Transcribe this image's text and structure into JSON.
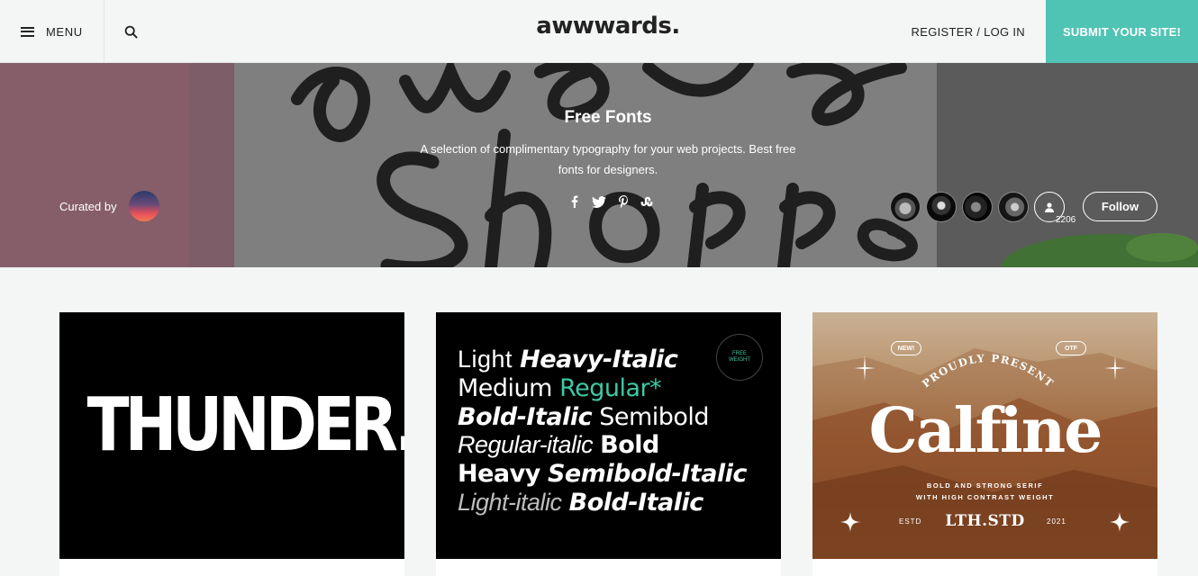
{
  "header": {
    "menu_label": "MENU",
    "logo": "awwwards.",
    "login_label": "REGISTER / LOG IN",
    "submit_label": "SUBMIT YOUR SITE!"
  },
  "hero": {
    "title": "Free Fonts",
    "description_line1": "A selection of complimentary typography for your web projects. Best free",
    "description_line2": "fonts for designers.",
    "curated_by_label": "Curated by",
    "social_icons": [
      "facebook-icon",
      "twitter-icon",
      "pinterest-icon",
      "stumbleupon-icon"
    ],
    "follower_count": "2206",
    "follow_label": "Follow"
  },
  "cards": [
    {
      "thumb_text": "THUNDER."
    },
    {
      "rows": [
        [
          "Light",
          "Heavy-Italic"
        ],
        [
          "Medium",
          "Regular*"
        ],
        [
          "Bold-Italic",
          "Semibold"
        ],
        [
          "Regular-italic",
          "Bold"
        ],
        [
          "Heavy",
          "Semibold-Italic"
        ],
        [
          "Light-italic",
          "Bold-Italic"
        ]
      ],
      "badge_line1": "FREE",
      "badge_line2": "WEIGHT"
    },
    {
      "pill_left": "NEW!",
      "pill_right": "OTF",
      "arc_text": "PROUDLY PRESENT",
      "title": "Calfine",
      "sub_line1": "BOLD AND STRONG SERIF",
      "sub_line2": "WITH HIGH CONTRAST WEIGHT",
      "foot_left": "ESTD",
      "foot_mid": "LTH.STD",
      "foot_right": "2021"
    }
  ],
  "colors": {
    "accent": "#4fc4b4",
    "teal_text": "#3ec9a6"
  }
}
